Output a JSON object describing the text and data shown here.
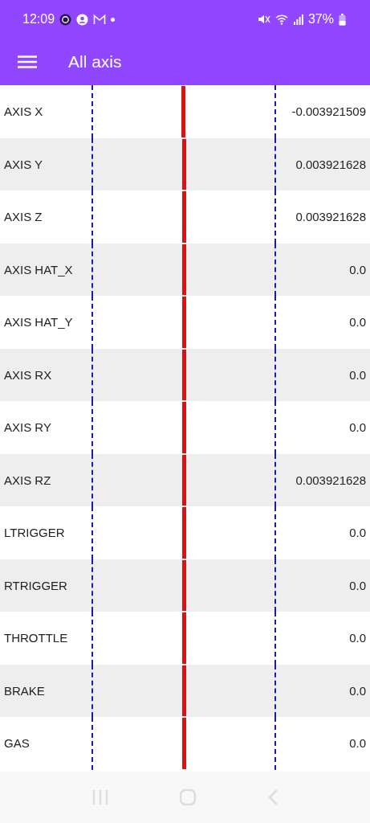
{
  "status_bar": {
    "time": "12:09",
    "battery": "37%"
  },
  "app_bar": {
    "title": "All axis"
  },
  "axes": [
    {
      "name": "AXIS X",
      "level": 0.498,
      "reading": "-0.003921509"
    },
    {
      "name": "AXIS Y",
      "level": 0.502,
      "reading": "0.003921628"
    },
    {
      "name": "AXIS Z",
      "level": 0.502,
      "reading": "0.003921628"
    },
    {
      "name": "AXIS HAT_X",
      "level": 0.5,
      "reading": "0.0"
    },
    {
      "name": "AXIS HAT_Y",
      "level": 0.5,
      "reading": "0.0"
    },
    {
      "name": "AXIS RX",
      "level": 0.5,
      "reading": "0.0"
    },
    {
      "name": "AXIS RY",
      "level": 0.5,
      "reading": "0.0"
    },
    {
      "name": "AXIS RZ",
      "level": 0.502,
      "reading": "0.003921628"
    },
    {
      "name": "LTRIGGER",
      "level": 0.5,
      "reading": "0.0"
    },
    {
      "name": "RTRIGGER",
      "level": 0.5,
      "reading": "0.0"
    },
    {
      "name": "THROTTLE",
      "level": 0.5,
      "reading": "0.0"
    },
    {
      "name": "BRAKE",
      "level": 0.5,
      "reading": "0.0"
    },
    {
      "name": "GAS",
      "level": 0.5,
      "reading": "0.0"
    }
  ]
}
